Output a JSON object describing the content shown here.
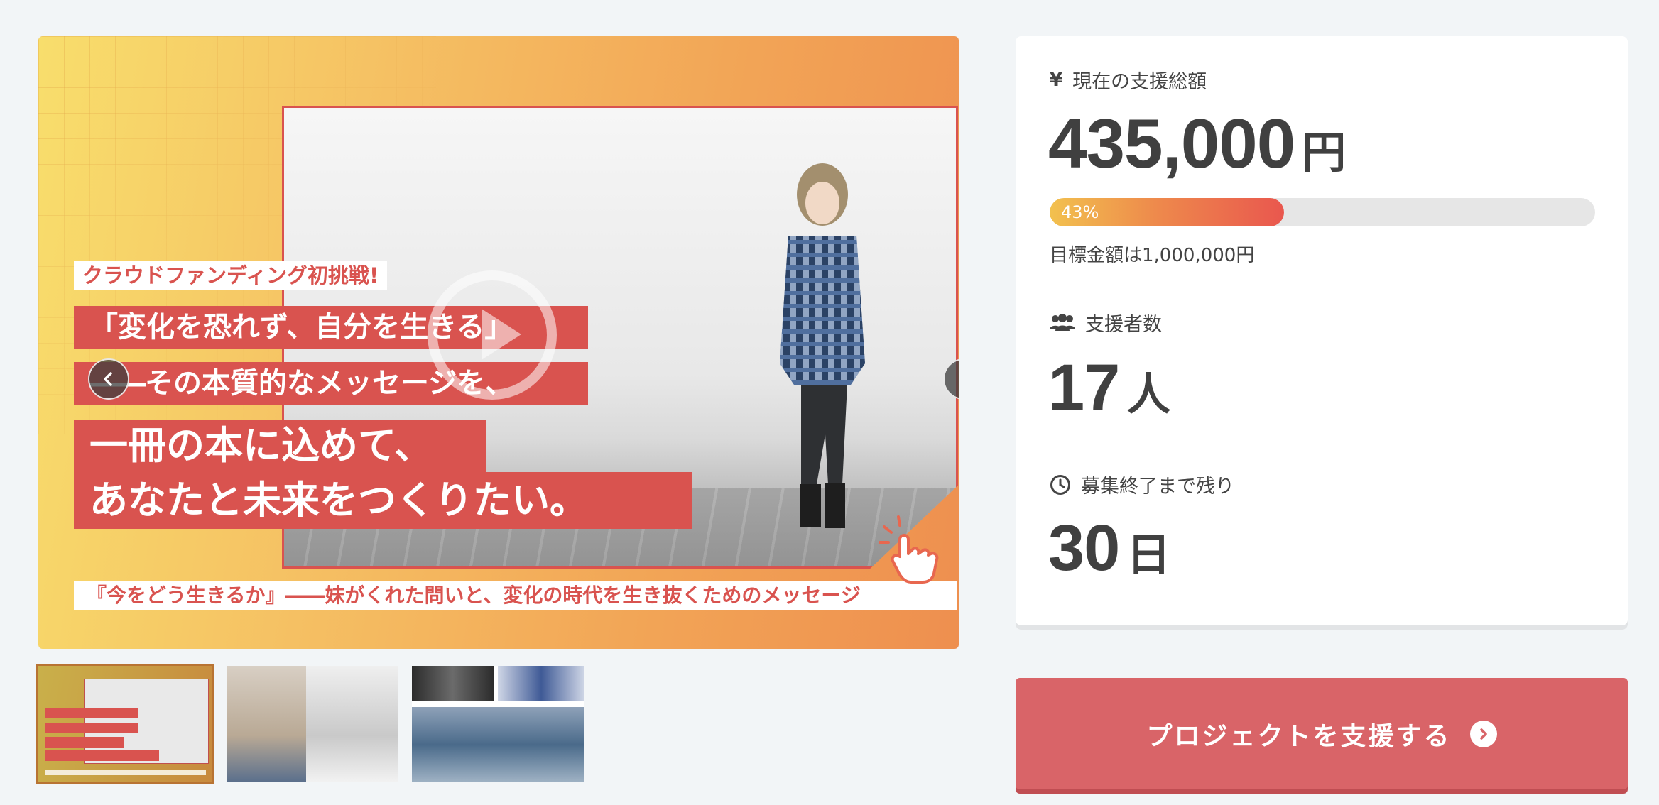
{
  "hero": {
    "badge": "クラウドファンディング初挑戦!",
    "line1": "「変化を恐れず、自分を生きる」",
    "line2": "その本質的なメッセージを、",
    "line2_dash": "――",
    "line3": "一冊の本に込めて、",
    "line4": "あなたと未来をつくりたい。",
    "subtitle": "『今をどう生きるか』――妹がくれた問いと、変化の時代を生き抜くためのメッセージ",
    "prev_icon": "chevron-left-icon",
    "next_icon": "chevron-right-icon",
    "play_icon": "play-icon",
    "hand_icon": "pointing-hand-icon"
  },
  "thumbnails": [
    {
      "name": "thumbnail-main-visual"
    },
    {
      "name": "thumbnail-portraits"
    },
    {
      "name": "thumbnail-group-photos"
    }
  ],
  "stats": {
    "amount_label": "現在の支援総額",
    "amount_icon": "yen-icon",
    "amount_value": "435,000",
    "amount_unit": "円",
    "progress_percent": 43,
    "progress_text": "43%",
    "goal_text": "目標金額は1,000,000円",
    "supporters_label": "支援者数",
    "supporters_icon": "users-icon",
    "supporters_value": "17",
    "supporters_unit": "人",
    "remaining_label": "募集終了まで残り",
    "remaining_icon": "clock-icon",
    "remaining_value": "30",
    "remaining_unit": "日"
  },
  "cta": {
    "label": "プロジェクトを支援する",
    "icon": "chevron-circle-right-icon"
  },
  "colors": {
    "accent": "#d9534f",
    "button": "#d96468",
    "progress_start": "#f2c14e",
    "progress_end": "#e9574e"
  }
}
